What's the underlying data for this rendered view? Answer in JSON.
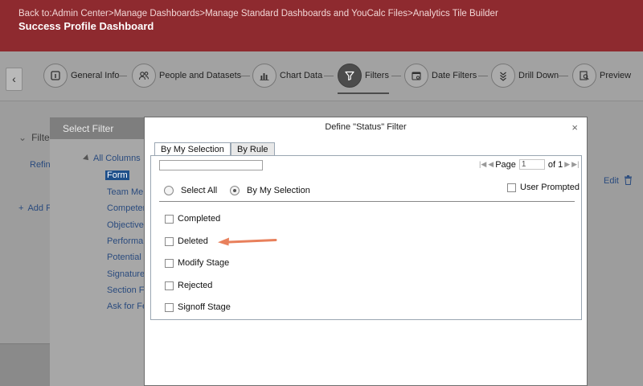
{
  "header": {
    "breadcrumb": {
      "prefix": "Back to:",
      "items": [
        "Admin Center",
        "Manage Dashboards",
        "Manage Standard Dashboards and YouCalc Files",
        "Analytics Tile Builder"
      ],
      "separator": ">"
    },
    "title": "Success Profile Dashboard"
  },
  "stepper": {
    "back_icon": "chevron-left-icon",
    "active_index": 3,
    "steps": [
      {
        "label": "General Info",
        "icon": "info-icon"
      },
      {
        "label": "People and Datasets",
        "icon": "people-icon"
      },
      {
        "label": "Chart Data",
        "icon": "bar-chart-icon"
      },
      {
        "label": "Filters",
        "icon": "funnel-icon"
      },
      {
        "label": "Date Filters",
        "icon": "calendar-icon"
      },
      {
        "label": "Drill Down",
        "icon": "chevrons-down-icon"
      },
      {
        "label": "Preview",
        "icon": "magnifier-icon"
      }
    ]
  },
  "background_page": {
    "filters_heading": "Filte",
    "refine_link": "Refin",
    "add_link": "Add F",
    "edit_link": "Edit"
  },
  "select_filter": {
    "title": "Select Filter",
    "tree_root": "All Columns",
    "tree_items": [
      "Form",
      "Team Mer",
      "Competen",
      "Objectives",
      "Performan",
      "Potential",
      "Signature",
      "Section Fi",
      "Ask for Fe"
    ],
    "selected_item": "Form"
  },
  "modal": {
    "title": "Define \"Status\" Filter",
    "close_glyph": "×",
    "tabs": [
      {
        "label": "By My Selection",
        "active": true
      },
      {
        "label": "By Rule",
        "active": false
      }
    ],
    "search": {
      "value": "",
      "placeholder": ""
    },
    "pager": {
      "label": "Page",
      "page": "1",
      "of_label": "of 1"
    },
    "radios": [
      {
        "label": "Select All",
        "checked": false
      },
      {
        "label": "By My Selection",
        "checked": true
      }
    ],
    "user_prompted": {
      "label": "User Prompted",
      "checked": false
    },
    "options": [
      {
        "label": "Completed",
        "checked": false
      },
      {
        "label": "Deleted",
        "checked": false
      },
      {
        "label": "Modify Stage",
        "checked": false
      },
      {
        "label": "Rejected",
        "checked": false
      },
      {
        "label": "Signoff Stage",
        "checked": false
      }
    ]
  },
  "colors": {
    "header": "#8e2a2f",
    "annotation_arrow": "#e8805c",
    "link": "#2a4b7e"
  }
}
